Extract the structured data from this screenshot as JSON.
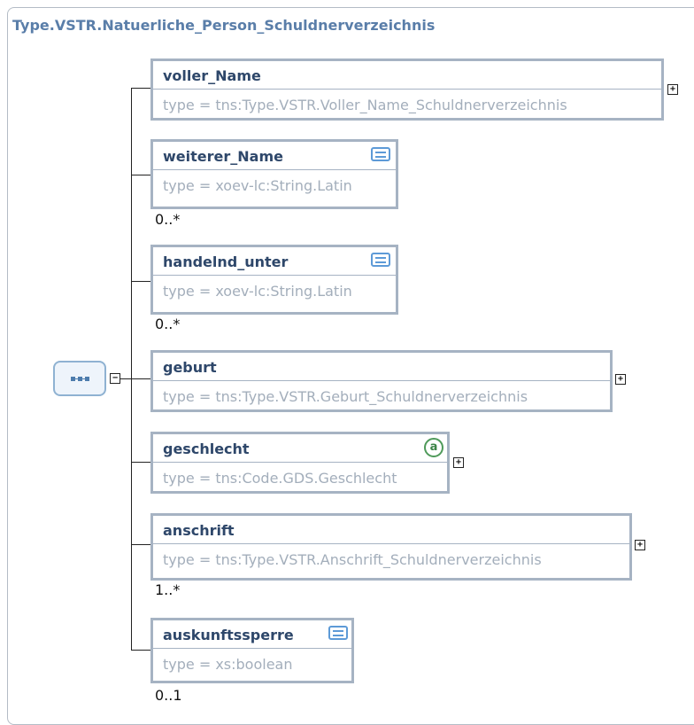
{
  "diagram": {
    "title": "Type.VSTR.Natuerliche_Person_Schuldnerverzeichnis",
    "elements": [
      {
        "name": "voller_Name",
        "type": "type = tns:Type.VSTR.Voller_Name_Schuldnerverzeichnis",
        "cardinality": "",
        "expandable": true
      },
      {
        "name": "weiterer_Name",
        "type": "type = xoev-lc:String.Latin",
        "cardinality": "0..*",
        "icon": "documentation-icon"
      },
      {
        "name": "handelnd_unter",
        "type": "type = xoev-lc:String.Latin",
        "cardinality": "0..*",
        "icon": "documentation-icon"
      },
      {
        "name": "geburt",
        "type": "type = tns:Type.VSTR.Geburt_Schuldnerverzeichnis",
        "cardinality": "",
        "expandable": true
      },
      {
        "name": "geschlecht",
        "type": "type = tns:Code.GDS.Geschlecht",
        "cardinality": "",
        "expandable": true,
        "icon": "attribute-icon",
        "icon_glyph": "a"
      },
      {
        "name": "anschrift",
        "type": "type = tns:Type.VSTR.Anschrift_Schuldnerverzeichnis",
        "cardinality": "1..*",
        "expandable": true
      },
      {
        "name": "auskunftssperre",
        "type": "type = xs:boolean",
        "cardinality": "0..1",
        "icon": "documentation-icon"
      }
    ],
    "expand_symbol": "+",
    "collapse_symbol": "−",
    "colors": {
      "title": "#5a7ea9",
      "element_border": "#a6b3c3",
      "element_name": "#2e476a",
      "type_text": "#a3aebb",
      "doc_icon": "#5d9ad7",
      "attr_icon": "#4f9a5a",
      "sequence_fill": "#eef4fb"
    }
  }
}
